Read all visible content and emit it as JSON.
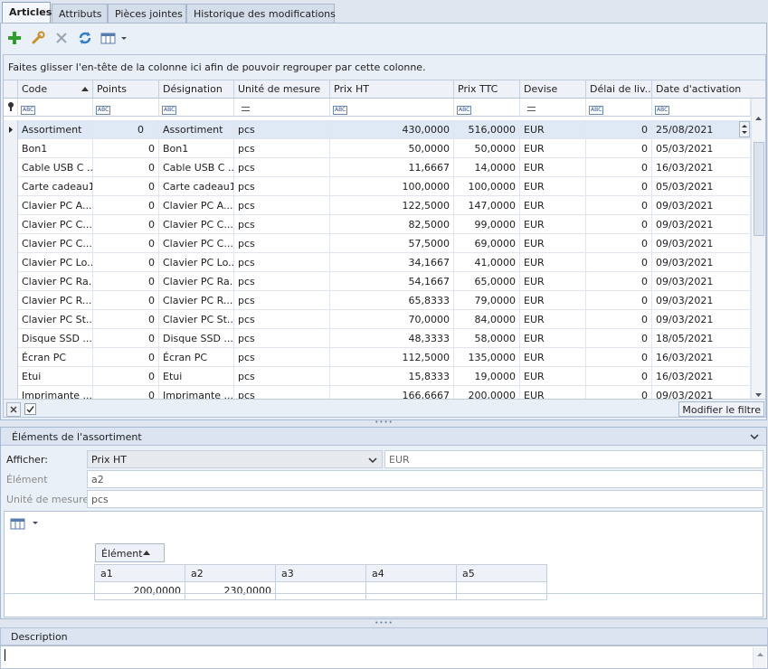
{
  "tabs": [
    "Articles",
    "Attributs",
    "Pièces jointes",
    "Historique des modifications"
  ],
  "group_hint": "Faites glisser l'en-tête de la colonne ici afin de pouvoir regrouper par cette colonne.",
  "columns": [
    "Code",
    "Points",
    "Désignation",
    "Unité de mesure",
    "Prix HT",
    "Prix TTC",
    "Devise",
    "Délai de liv...",
    "Date d'activation"
  ],
  "filter_labels": {
    "abc": "ABC"
  },
  "rows": [
    [
      "Assortiment",
      "0",
      "Assortiment",
      "pcs",
      "430,0000",
      "516,0000",
      "EUR",
      "0",
      "25/08/2021"
    ],
    [
      "Bon1",
      "0",
      "Bon1",
      "pcs",
      "50,0000",
      "50,0000",
      "EUR",
      "0",
      "05/03/2021"
    ],
    [
      "Cable USB C ...",
      "0",
      "Cable USB C ...",
      "pcs",
      "11,6667",
      "14,0000",
      "EUR",
      "0",
      "16/03/2021"
    ],
    [
      "Carte cadeau1",
      "0",
      "Carte cadeau1",
      "pcs",
      "100,0000",
      "100,0000",
      "EUR",
      "0",
      "05/03/2021"
    ],
    [
      "Clavier PC A...",
      "0",
      "Clavier PC A...",
      "pcs",
      "122,5000",
      "147,0000",
      "EUR",
      "0",
      "09/03/2021"
    ],
    [
      "Clavier PC C...",
      "0",
      "Clavier PC C...",
      "pcs",
      "82,5000",
      "99,0000",
      "EUR",
      "0",
      "09/03/2021"
    ],
    [
      "Clavier PC C...",
      "0",
      "Clavier PC C...",
      "pcs",
      "57,5000",
      "69,0000",
      "EUR",
      "0",
      "09/03/2021"
    ],
    [
      "Clavier PC Lo...",
      "0",
      "Clavier PC Lo...",
      "pcs",
      "34,1667",
      "41,0000",
      "EUR",
      "0",
      "09/03/2021"
    ],
    [
      "Clavier PC Ra...",
      "0",
      "Clavier PC Ra...",
      "pcs",
      "54,1667",
      "65,0000",
      "EUR",
      "0",
      "09/03/2021"
    ],
    [
      "Clavier PC R...",
      "0",
      "Clavier PC R...",
      "pcs",
      "65,8333",
      "79,0000",
      "EUR",
      "0",
      "09/03/2021"
    ],
    [
      "Clavier PC St...",
      "0",
      "Clavier PC St...",
      "pcs",
      "70,0000",
      "84,0000",
      "EUR",
      "0",
      "09/03/2021"
    ],
    [
      "Disque SSD ...",
      "0",
      "Disque SSD ...",
      "pcs",
      "48,3333",
      "58,0000",
      "EUR",
      "0",
      "18/05/2021"
    ],
    [
      "Écran PC",
      "0",
      "Écran PC",
      "pcs",
      "112,5000",
      "135,0000",
      "EUR",
      "0",
      "16/03/2021"
    ],
    [
      "Etui",
      "0",
      "Etui",
      "pcs",
      "15,8333",
      "19,0000",
      "EUR",
      "0",
      "16/03/2021"
    ],
    [
      "Imprimante ...",
      "0",
      "Imprimante ...",
      "pcs",
      "166,6667",
      "200,0000",
      "EUR",
      "0",
      "09/03/2021"
    ]
  ],
  "footer": {
    "filter_button": "Modifier le filtre"
  },
  "assortment": {
    "title": "Éléments de l'assortiment",
    "show_label": "Afficher:",
    "show_value": "Prix HT",
    "currency": "EUR",
    "element_label": "Élément",
    "element_value": "a2",
    "unit_label": "Unité de mesure",
    "unit_value": "pcs",
    "pivot_field": "Élément",
    "pivot_columns": [
      "a1",
      "a2",
      "a3",
      "a4",
      "a5"
    ],
    "pivot_values": [
      "200,0000",
      "230,0000",
      "",
      "",
      ""
    ]
  },
  "description": {
    "title": "Description"
  },
  "colors": {
    "accent": "#2a4e86",
    "add_green": "#2e9e2e",
    "header_bg": "#dbe4f0"
  }
}
